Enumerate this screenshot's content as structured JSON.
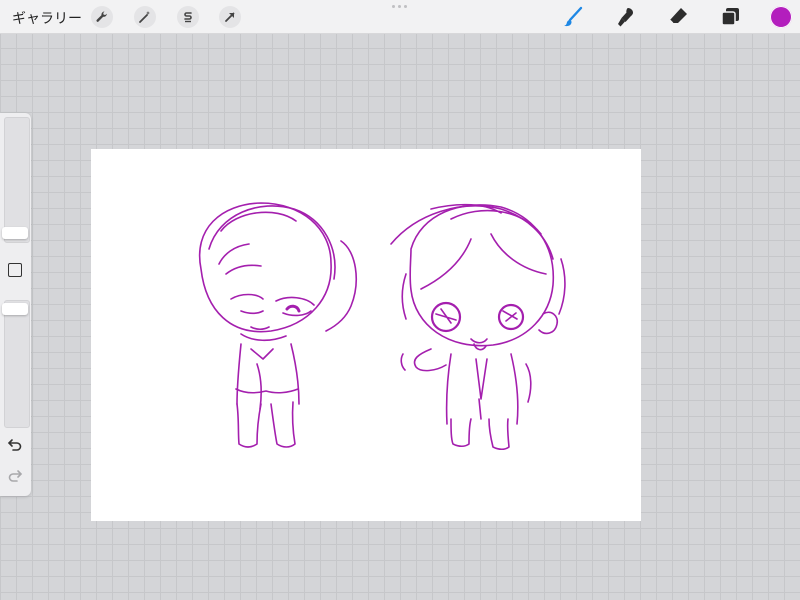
{
  "app": {
    "gallery_label": "ギャラリー"
  },
  "toolbar_left": {
    "icons": [
      "wrench-icon",
      "magic-wand-icon",
      "selection-icon",
      "transform-arrow-icon"
    ]
  },
  "toolbar_right": {
    "icons": [
      "brush-icon",
      "smudge-icon",
      "eraser-icon",
      "layers-icon"
    ],
    "active_tool": "brush-icon",
    "active_tool_color": "#1e88e5",
    "current_color": "#b31ebd"
  },
  "sidebar": {
    "brush_size_level": 0.88,
    "opacity_level": 0.94
  },
  "canvas": {
    "background": "#ffffff",
    "stroke_color": "#a41fae"
  }
}
